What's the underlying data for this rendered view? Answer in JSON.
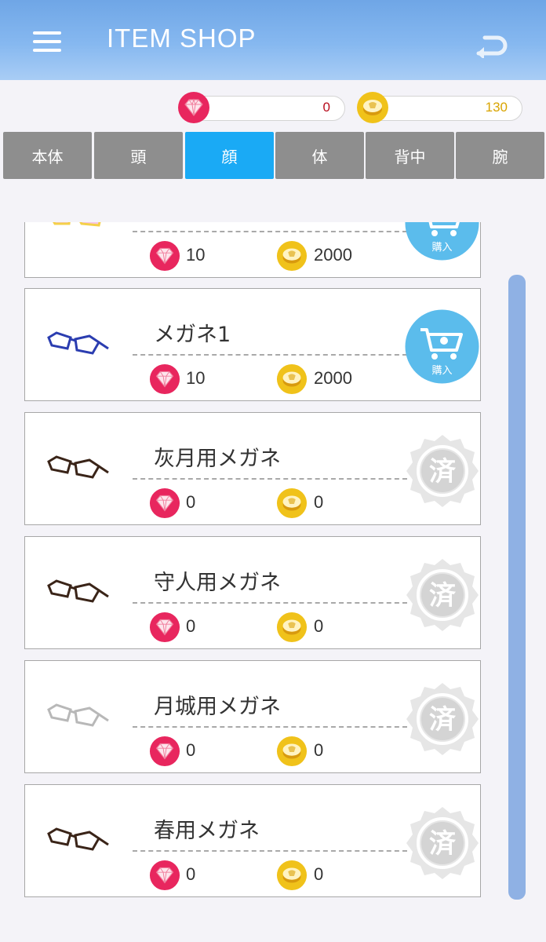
{
  "header": {
    "title": "ITEM SHOP",
    "menu_icon": "hamburger-menu-icon",
    "back_icon": "return-arrow-icon"
  },
  "currency": {
    "gems": "0",
    "coins": "130",
    "gem_color": "#e8265e",
    "coin_color": "#f0c21a"
  },
  "tabs": [
    {
      "label": "本体"
    },
    {
      "label": "頭"
    },
    {
      "label": "顔",
      "active": true
    },
    {
      "label": "体"
    },
    {
      "label": "背中"
    },
    {
      "label": "腕"
    }
  ],
  "items": [
    {
      "name": "",
      "gems": "10",
      "coins": "2000",
      "status": "purchase",
      "button_label": "購入"
    },
    {
      "name": "メガネ1",
      "gems": "10",
      "coins": "2000",
      "status": "purchase",
      "button_label": "購入"
    },
    {
      "name": "灰月用メガネ",
      "gems": "0",
      "coins": "0",
      "status": "owned",
      "badge_label": "済"
    },
    {
      "name": "守人用メガネ",
      "gems": "0",
      "coins": "0",
      "status": "owned",
      "badge_label": "済"
    },
    {
      "name": "月城用メガネ",
      "gems": "0",
      "coins": "0",
      "status": "owned",
      "badge_label": "済"
    },
    {
      "name": "春用メガネ",
      "gems": "0",
      "coins": "0",
      "status": "owned",
      "badge_label": "済"
    }
  ],
  "colors": {
    "accent": "#1aaaf5",
    "tab_inactive": "#8e8e8e",
    "scrollbar": "#8fb1e4"
  }
}
